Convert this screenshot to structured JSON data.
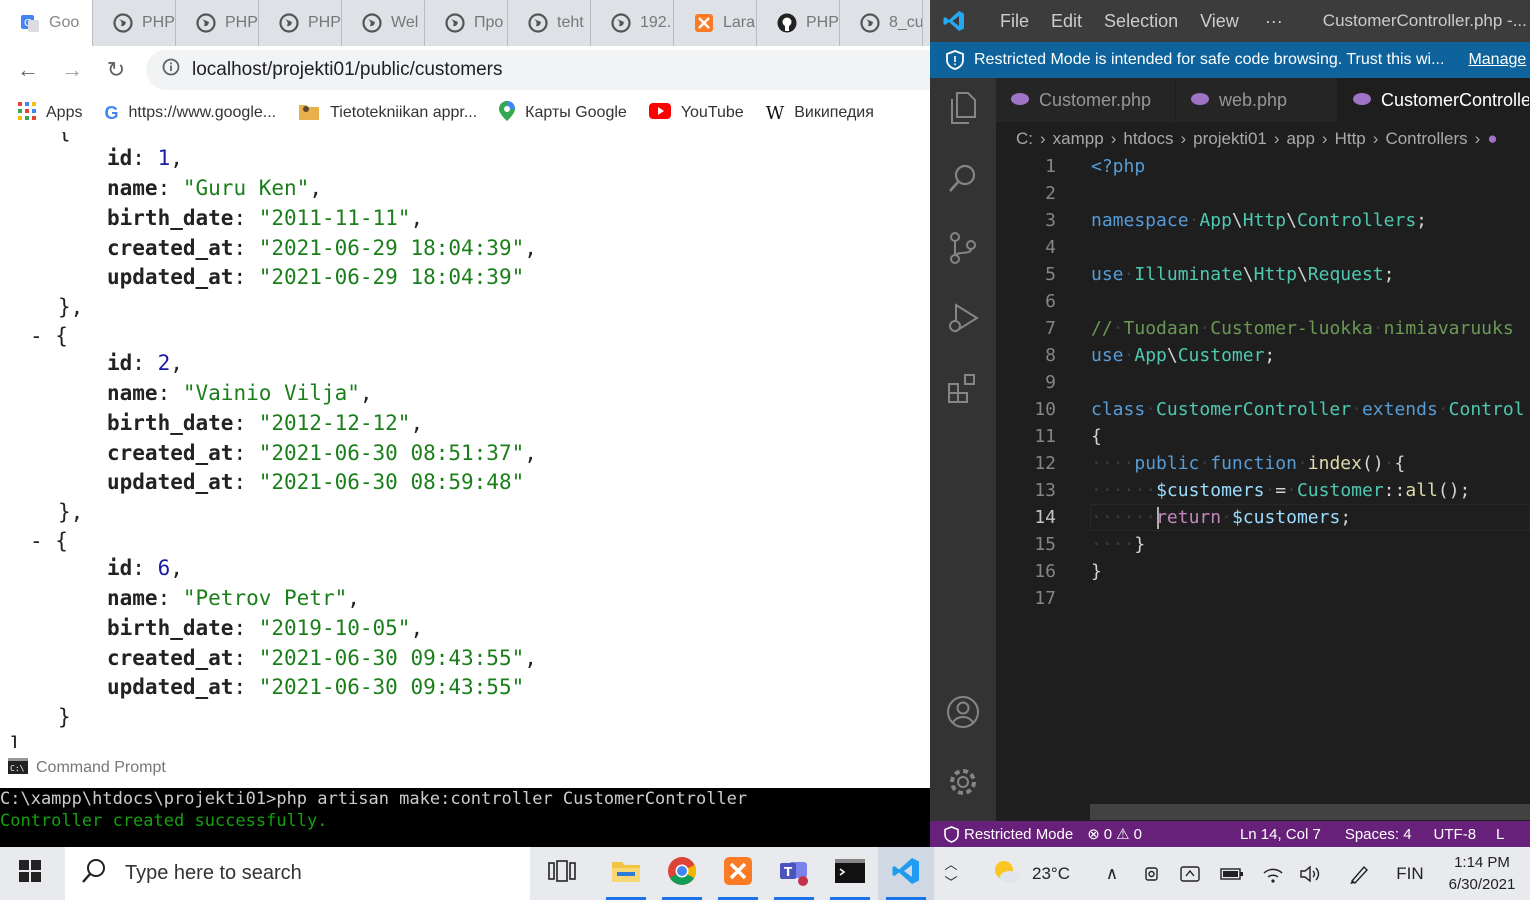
{
  "browser": {
    "tabs": [
      {
        "label": "Goo",
        "icon": "google-translate-icon"
      },
      {
        "label": "PHP",
        "icon": "globe-icon"
      },
      {
        "label": "PHP",
        "icon": "globe-icon"
      },
      {
        "label": "PHP",
        "icon": "globe-icon"
      },
      {
        "label": "Wel",
        "icon": "globe-icon"
      },
      {
        "label": "Про",
        "icon": "globe-icon"
      },
      {
        "label": "teht",
        "icon": "globe-icon"
      },
      {
        "label": "192.",
        "icon": "globe-icon"
      },
      {
        "label": "Lara",
        "icon": "xampp-icon"
      },
      {
        "label": "PHP",
        "icon": "github-icon"
      },
      {
        "label": "8_cu",
        "icon": "globe-icon"
      }
    ],
    "url": "localhost/projekti01/public/customers",
    "bookmarks": [
      {
        "label": "Apps",
        "icon": "apps-grid-icon"
      },
      {
        "label": "https://www.google...",
        "icon": "google-icon"
      },
      {
        "label": "Tietotekniikan appr...",
        "icon": "folder-icon"
      },
      {
        "label": "Карты Google",
        "icon": "maps-pin-icon"
      },
      {
        "label": "YouTube",
        "icon": "youtube-icon"
      },
      {
        "label": "Википедия",
        "icon": "wikipedia-icon"
      }
    ],
    "json_partial_top": "{",
    "json_closing": "]",
    "customers": [
      {
        "id": "1",
        "name": "\"Guru Ken\"",
        "birth_date": "\"2011-11-11\"",
        "created_at": "\"2021-06-29 18:04:39\"",
        "updated_at": "\"2021-06-29 18:04:39\""
      },
      {
        "id": "2",
        "name": "\"Vainio Vilja\"",
        "birth_date": "\"2012-12-12\"",
        "created_at": "\"2021-06-30 08:51:37\"",
        "updated_at": "\"2021-06-30 08:59:48\""
      },
      {
        "id": "6",
        "name": "\"Petrov Petr\"",
        "birth_date": "\"2019-10-05\"",
        "created_at": "\"2021-06-30 09:43:55\"",
        "updated_at": "\"2021-06-30 09:43:55\""
      }
    ],
    "keys": {
      "id": "id",
      "name": "name",
      "birth_date": "birth_date",
      "created_at": "created_at",
      "updated_at": "updated_at"
    }
  },
  "cmd": {
    "title": "Command Prompt",
    "line1": "C:\\xampp\\htdocs\\projekti01>php artisan make:controller CustomerController",
    "line2": "Controller created successfully.",
    "success_color": "#13a10e"
  },
  "vscode": {
    "menu": [
      "File",
      "Edit",
      "Selection",
      "View",
      "···"
    ],
    "window_title": "CustomerController.php -...",
    "banner_text": "Restricted Mode is intended for safe code browsing. Trust this wi...",
    "banner_link": "Manage",
    "tabs": [
      {
        "label": "Customer.php",
        "active": false
      },
      {
        "label": "web.php",
        "active": false
      },
      {
        "label": "CustomerController",
        "active": true
      }
    ],
    "breadcrumb": [
      "C:",
      "xampp",
      "htdocs",
      "projekti01",
      "app",
      "Http",
      "Controllers"
    ],
    "current_line": 14,
    "code": [
      "<?php",
      "",
      "namespace App\\Http\\Controllers;",
      "",
      "use Illuminate\\Http\\Request;",
      "",
      "// Tuodaan Customer-luokka nimiavaruuks",
      "use App\\Customer;",
      "",
      "class CustomerController extends Control",
      "{",
      "    public function index() {",
      "      $customers = Customer::all();",
      "      return $customers;",
      "    }",
      "}",
      ""
    ],
    "status": {
      "mode": "Restricted Mode",
      "errors": "0",
      "warnings": "0",
      "position": "Ln 14, Col 7",
      "spaces": "Spaces: 4",
      "encoding": "UTF-8",
      "eol": "L"
    },
    "colors": {
      "status_bg": "#68217a",
      "banner_bg": "#0e639c",
      "accent": "#007acc"
    }
  },
  "taskbar": {
    "search_placeholder": "Type here to search",
    "weather": "23°C",
    "language": "FIN",
    "time": "1:14 PM",
    "date": "6/30/2021"
  }
}
